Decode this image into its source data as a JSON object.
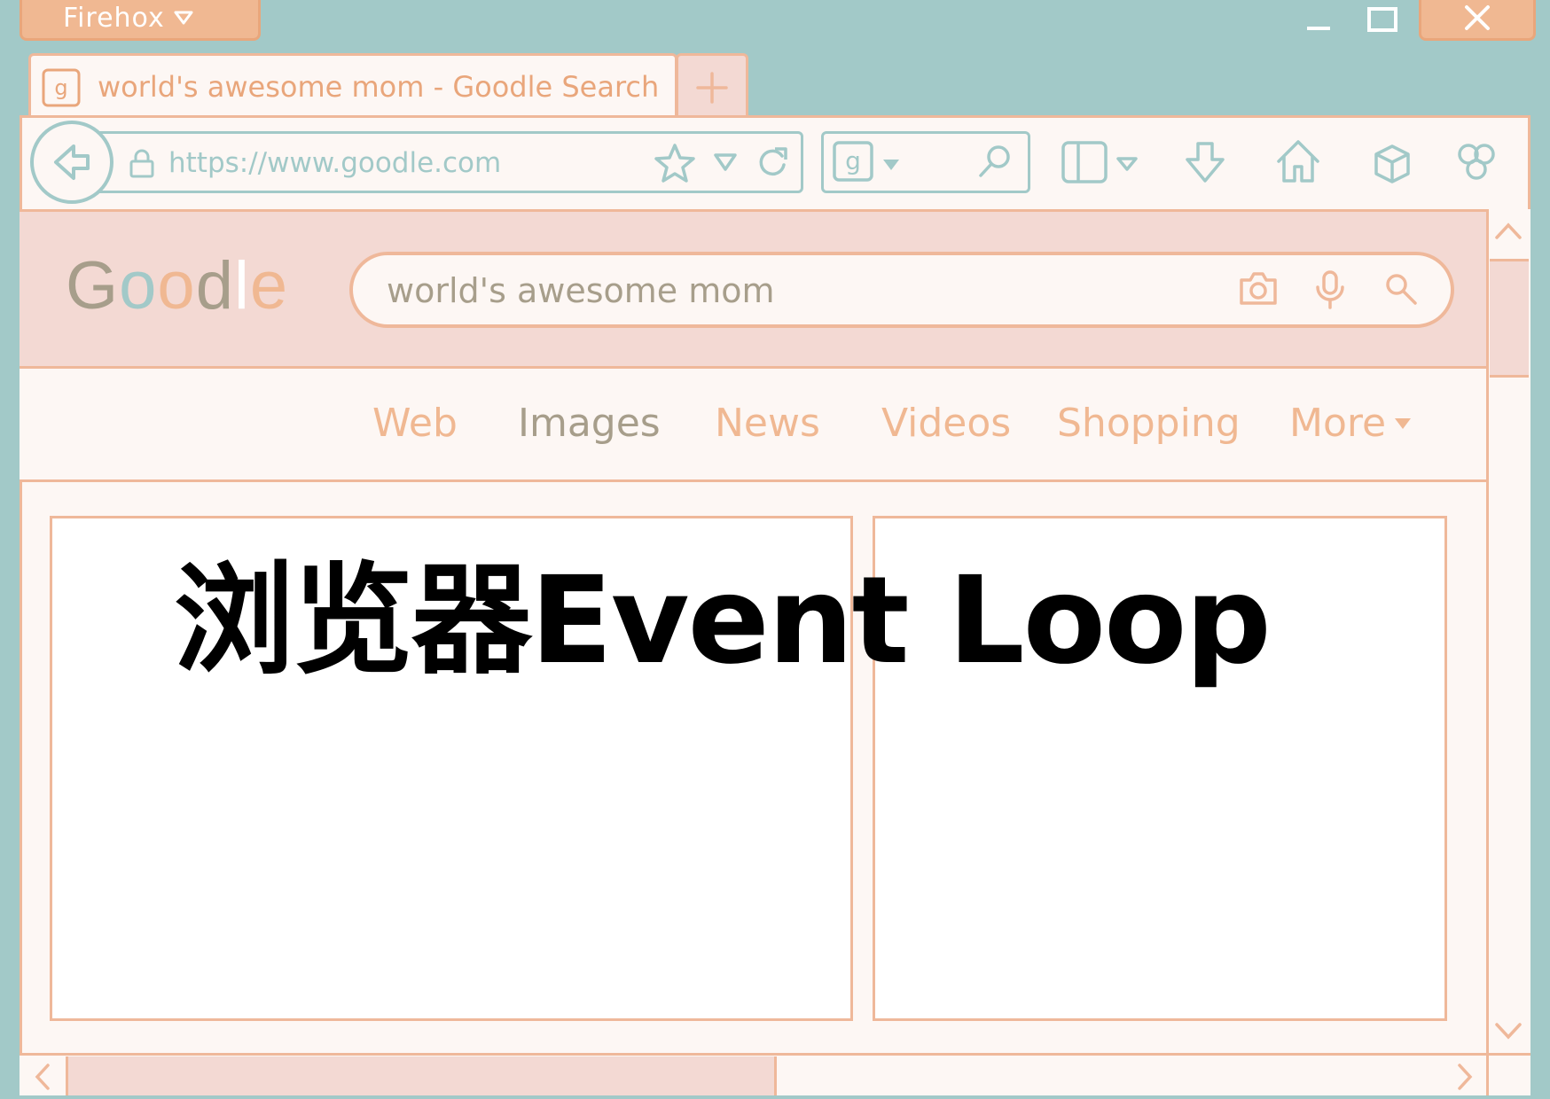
{
  "browser_menu": {
    "label": "Firehox"
  },
  "tab": {
    "title": "world's awesome mom - Goodle Search",
    "favicon_letter": "g"
  },
  "toolbar": {
    "url": "https://www.goodle.com",
    "search_engine_letter": "g"
  },
  "page": {
    "logo_letters": [
      "G",
      "o",
      "o",
      "d",
      "l",
      "e"
    ],
    "logo_colors": [
      "#a79e8b",
      "#a2c9c8",
      "#f0b892",
      "#a79e8b",
      "#ffffff",
      "#f0b892"
    ],
    "search_query": "world's awesome mom",
    "nav_tabs": [
      "Web",
      "Images",
      "News",
      "Videos",
      "Shopping",
      "More"
    ],
    "headline": "浏览器Event Loop"
  },
  "colors": {
    "teal": "#a2c9c8",
    "peach": "#f0b892",
    "peach_border": "#efb89a",
    "pink": "#f3d9d3",
    "cream": "#fdf7f4",
    "taupe": "#a79e8b"
  }
}
